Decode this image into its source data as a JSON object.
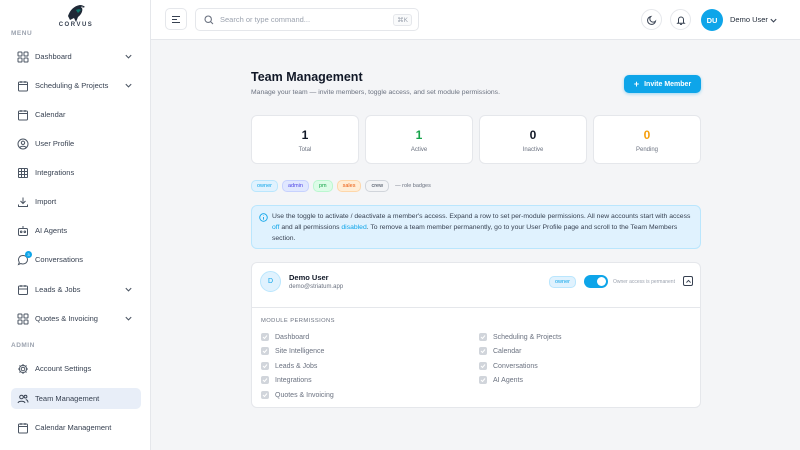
{
  "brand": {
    "name": "CORVUS"
  },
  "sidebar": {
    "section_menu": "MENU",
    "section_admin": "ADMIN",
    "items": [
      {
        "label": "Dashboard",
        "icon": "grid-icon",
        "has_chevron": true
      },
      {
        "label": "Scheduling & Projects",
        "icon": "calendar-icon",
        "has_chevron": true
      },
      {
        "label": "Calendar",
        "icon": "calendar-icon",
        "has_chevron": false
      },
      {
        "label": "User Profile",
        "icon": "user-circle-icon",
        "has_chevron": false
      },
      {
        "label": "Integrations",
        "icon": "table-icon",
        "has_chevron": false
      },
      {
        "label": "Import",
        "icon": "download-icon",
        "has_chevron": false
      },
      {
        "label": "AI Agents",
        "icon": "bot-icon",
        "has_chevron": false
      },
      {
        "label": "Conversations",
        "icon": "chat-icon",
        "has_chevron": false,
        "badge": "3"
      },
      {
        "label": "Leads & Jobs",
        "icon": "layers-icon",
        "has_chevron": true
      },
      {
        "label": "Quotes & Invoicing",
        "icon": "grid-icon",
        "has_chevron": true
      }
    ],
    "admin_items": [
      {
        "label": "Account Settings",
        "icon": "gear-icon"
      },
      {
        "label": "Team Management",
        "icon": "users-icon",
        "active": true
      },
      {
        "label": "Calendar Management",
        "icon": "calendar-icon"
      }
    ]
  },
  "topbar": {
    "search_placeholder": "Search or type command...",
    "shortcut": "⌘K",
    "user_initials": "DU",
    "user_name": "Demo User"
  },
  "page": {
    "title": "Team Management",
    "subtitle": "Manage your team — invite members, toggle access, and set module permissions.",
    "invite_label": "Invite Member"
  },
  "stats": [
    {
      "value": "1",
      "label": "Total",
      "color": "#111827"
    },
    {
      "value": "1",
      "label": "Active",
      "color": "#16a34a"
    },
    {
      "value": "0",
      "label": "Inactive",
      "color": "#111827"
    },
    {
      "value": "0",
      "label": "Pending",
      "color": "#f59e0b"
    }
  ],
  "roles": {
    "badges": [
      {
        "label": "owner",
        "color": "#0ea5e9",
        "bg": "#e0f2fe",
        "border": "#bae6fd"
      },
      {
        "label": "admin",
        "color": "#4f46e5",
        "bg": "#e0e7ff",
        "border": "#c7d2fe"
      },
      {
        "label": "pm",
        "color": "#16a34a",
        "bg": "#dcfce7",
        "border": "#bbf7d0"
      },
      {
        "label": "sales",
        "color": "#ea580c",
        "bg": "#ffedd5",
        "border": "#fed7aa"
      },
      {
        "label": "crew",
        "color": "#374151",
        "bg": "#f3f4f6",
        "border": "#d1d5db"
      }
    ],
    "note": "— role badges"
  },
  "info": {
    "part1": "Use the toggle to activate / deactivate a member's access. Expand a row to set per-module permissions. All new accounts start with access ",
    "off": "off",
    "part2": " and all permissions ",
    "disabled": "disabled",
    "part3": ". To remove a team member permanently, go to your User Profile page and scroll to the Team Members section."
  },
  "member": {
    "initial": "D",
    "name": "Demo User",
    "email": "demo@striatum.app",
    "role": "owner",
    "active": true,
    "note": "Owner access is permanent"
  },
  "permissions": {
    "label": "MODULE PERMISSIONS",
    "left": [
      "Dashboard",
      "Site Intelligence",
      "Leads & Jobs",
      "Integrations",
      "Quotes & Invoicing"
    ],
    "right": [
      "Scheduling & Projects",
      "Calendar",
      "Conversations",
      "AI Agents"
    ]
  }
}
